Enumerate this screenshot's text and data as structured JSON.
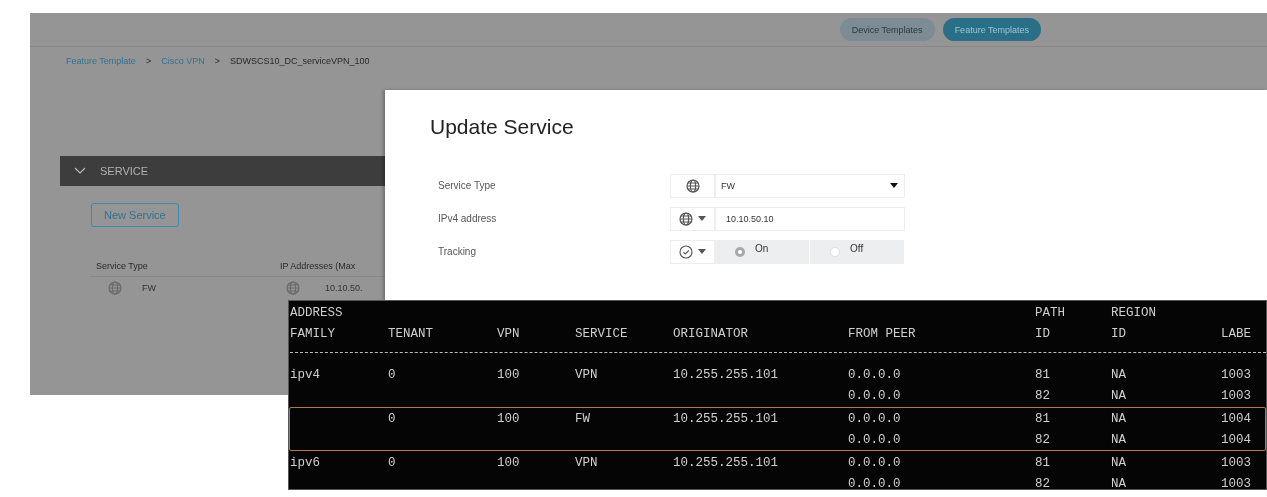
{
  "app": {
    "nav_pills": [
      {
        "label": "Device Templates",
        "selected": false
      },
      {
        "label": "Feature Templates",
        "selected": true
      }
    ],
    "breadcrumb": [
      {
        "label": "Feature Template",
        "kind": "link"
      },
      {
        "label": ">",
        "kind": "sep"
      },
      {
        "label": "Cisco VPN",
        "kind": "link"
      },
      {
        "label": ">",
        "kind": "sep"
      },
      {
        "label": "SDWSCS10_DC_serviceVPN_100",
        "kind": "current"
      }
    ],
    "section": {
      "title": "SERVICE",
      "expanded": true
    },
    "new_button": "New Service",
    "table": {
      "columns": [
        "Service Type",
        "IP Addresses (Max"
      ],
      "rows": [
        {
          "service_type": "FW",
          "ip": "10.10.50."
        }
      ]
    }
  },
  "modal": {
    "title": "Update Service",
    "fields": [
      {
        "label": "Service Type",
        "kind": "select",
        "value": "FW"
      },
      {
        "label": "IPv4 address",
        "kind": "input",
        "value": "10.10.50.10"
      },
      {
        "label": "Tracking",
        "kind": "radio",
        "options": [
          {
            "label": "On",
            "selected": true
          },
          {
            "label": "Off",
            "selected": false
          }
        ]
      }
    ]
  },
  "terminal": {
    "header_top": {
      "address": "ADDRESS",
      "path": "PATH",
      "region": "REGION"
    },
    "columns": [
      "FAMILY",
      "TENANT",
      "VPN",
      "SERVICE",
      "ORIGINATOR",
      "FROM PEER",
      "ID",
      "ID",
      "LABE"
    ],
    "groups": [
      {
        "family": "ipv4",
        "tenant": "0",
        "vpn": "100",
        "service": "VPN",
        "originator": "10.255.255.101",
        "highlighted": false,
        "paths": [
          {
            "from_peer": "0.0.0.0",
            "path_id": "81",
            "region_id": "NA",
            "label": "1003"
          },
          {
            "from_peer": "0.0.0.0",
            "path_id": "82",
            "region_id": "NA",
            "label": "1003"
          }
        ]
      },
      {
        "tenant": "0",
        "vpn": "100",
        "service": "FW",
        "originator": "10.255.255.101",
        "highlighted": true,
        "paths": [
          {
            "from_peer": "0.0.0.0",
            "path_id": "81",
            "region_id": "NA",
            "label": "1004"
          },
          {
            "from_peer": "0.0.0.0",
            "path_id": "82",
            "region_id": "NA",
            "label": "1004"
          }
        ]
      },
      {
        "family": "ipv6",
        "tenant": "0",
        "vpn": "100",
        "service": "VPN",
        "originator": "10.255.255.101",
        "highlighted": false,
        "paths": [
          {
            "from_peer": "0.0.0.0",
            "path_id": "81",
            "region_id": "NA",
            "label": "1003"
          },
          {
            "from_peer": "0.0.0.0",
            "path_id": "82",
            "region_id": "NA",
            "label": "1003"
          }
        ]
      }
    ]
  }
}
